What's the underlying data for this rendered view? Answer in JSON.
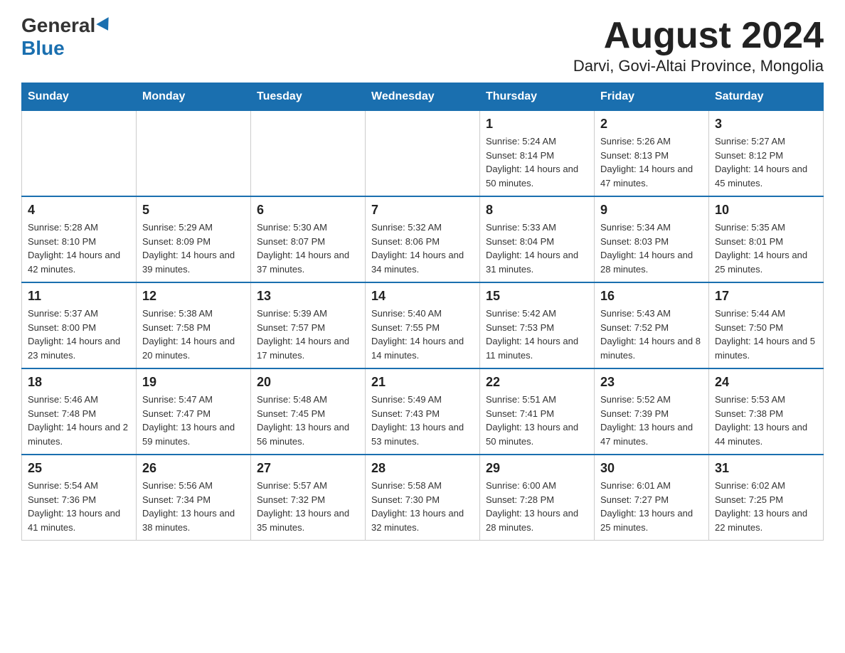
{
  "logo": {
    "general": "General",
    "blue": "Blue"
  },
  "title": "August 2024",
  "subtitle": "Darvi, Govi-Altai Province, Mongolia",
  "calendar": {
    "headers": [
      "Sunday",
      "Monday",
      "Tuesday",
      "Wednesday",
      "Thursday",
      "Friday",
      "Saturday"
    ],
    "weeks": [
      [
        {
          "day": "",
          "sunrise": "",
          "sunset": "",
          "daylight": ""
        },
        {
          "day": "",
          "sunrise": "",
          "sunset": "",
          "daylight": ""
        },
        {
          "day": "",
          "sunrise": "",
          "sunset": "",
          "daylight": ""
        },
        {
          "day": "",
          "sunrise": "",
          "sunset": "",
          "daylight": ""
        },
        {
          "day": "1",
          "sunrise": "Sunrise: 5:24 AM",
          "sunset": "Sunset: 8:14 PM",
          "daylight": "Daylight: 14 hours and 50 minutes."
        },
        {
          "day": "2",
          "sunrise": "Sunrise: 5:26 AM",
          "sunset": "Sunset: 8:13 PM",
          "daylight": "Daylight: 14 hours and 47 minutes."
        },
        {
          "day": "3",
          "sunrise": "Sunrise: 5:27 AM",
          "sunset": "Sunset: 8:12 PM",
          "daylight": "Daylight: 14 hours and 45 minutes."
        }
      ],
      [
        {
          "day": "4",
          "sunrise": "Sunrise: 5:28 AM",
          "sunset": "Sunset: 8:10 PM",
          "daylight": "Daylight: 14 hours and 42 minutes."
        },
        {
          "day": "5",
          "sunrise": "Sunrise: 5:29 AM",
          "sunset": "Sunset: 8:09 PM",
          "daylight": "Daylight: 14 hours and 39 minutes."
        },
        {
          "day": "6",
          "sunrise": "Sunrise: 5:30 AM",
          "sunset": "Sunset: 8:07 PM",
          "daylight": "Daylight: 14 hours and 37 minutes."
        },
        {
          "day": "7",
          "sunrise": "Sunrise: 5:32 AM",
          "sunset": "Sunset: 8:06 PM",
          "daylight": "Daylight: 14 hours and 34 minutes."
        },
        {
          "day": "8",
          "sunrise": "Sunrise: 5:33 AM",
          "sunset": "Sunset: 8:04 PM",
          "daylight": "Daylight: 14 hours and 31 minutes."
        },
        {
          "day": "9",
          "sunrise": "Sunrise: 5:34 AM",
          "sunset": "Sunset: 8:03 PM",
          "daylight": "Daylight: 14 hours and 28 minutes."
        },
        {
          "day": "10",
          "sunrise": "Sunrise: 5:35 AM",
          "sunset": "Sunset: 8:01 PM",
          "daylight": "Daylight: 14 hours and 25 minutes."
        }
      ],
      [
        {
          "day": "11",
          "sunrise": "Sunrise: 5:37 AM",
          "sunset": "Sunset: 8:00 PM",
          "daylight": "Daylight: 14 hours and 23 minutes."
        },
        {
          "day": "12",
          "sunrise": "Sunrise: 5:38 AM",
          "sunset": "Sunset: 7:58 PM",
          "daylight": "Daylight: 14 hours and 20 minutes."
        },
        {
          "day": "13",
          "sunrise": "Sunrise: 5:39 AM",
          "sunset": "Sunset: 7:57 PM",
          "daylight": "Daylight: 14 hours and 17 minutes."
        },
        {
          "day": "14",
          "sunrise": "Sunrise: 5:40 AM",
          "sunset": "Sunset: 7:55 PM",
          "daylight": "Daylight: 14 hours and 14 minutes."
        },
        {
          "day": "15",
          "sunrise": "Sunrise: 5:42 AM",
          "sunset": "Sunset: 7:53 PM",
          "daylight": "Daylight: 14 hours and 11 minutes."
        },
        {
          "day": "16",
          "sunrise": "Sunrise: 5:43 AM",
          "sunset": "Sunset: 7:52 PM",
          "daylight": "Daylight: 14 hours and 8 minutes."
        },
        {
          "day": "17",
          "sunrise": "Sunrise: 5:44 AM",
          "sunset": "Sunset: 7:50 PM",
          "daylight": "Daylight: 14 hours and 5 minutes."
        }
      ],
      [
        {
          "day": "18",
          "sunrise": "Sunrise: 5:46 AM",
          "sunset": "Sunset: 7:48 PM",
          "daylight": "Daylight: 14 hours and 2 minutes."
        },
        {
          "day": "19",
          "sunrise": "Sunrise: 5:47 AM",
          "sunset": "Sunset: 7:47 PM",
          "daylight": "Daylight: 13 hours and 59 minutes."
        },
        {
          "day": "20",
          "sunrise": "Sunrise: 5:48 AM",
          "sunset": "Sunset: 7:45 PM",
          "daylight": "Daylight: 13 hours and 56 minutes."
        },
        {
          "day": "21",
          "sunrise": "Sunrise: 5:49 AM",
          "sunset": "Sunset: 7:43 PM",
          "daylight": "Daylight: 13 hours and 53 minutes."
        },
        {
          "day": "22",
          "sunrise": "Sunrise: 5:51 AM",
          "sunset": "Sunset: 7:41 PM",
          "daylight": "Daylight: 13 hours and 50 minutes."
        },
        {
          "day": "23",
          "sunrise": "Sunrise: 5:52 AM",
          "sunset": "Sunset: 7:39 PM",
          "daylight": "Daylight: 13 hours and 47 minutes."
        },
        {
          "day": "24",
          "sunrise": "Sunrise: 5:53 AM",
          "sunset": "Sunset: 7:38 PM",
          "daylight": "Daylight: 13 hours and 44 minutes."
        }
      ],
      [
        {
          "day": "25",
          "sunrise": "Sunrise: 5:54 AM",
          "sunset": "Sunset: 7:36 PM",
          "daylight": "Daylight: 13 hours and 41 minutes."
        },
        {
          "day": "26",
          "sunrise": "Sunrise: 5:56 AM",
          "sunset": "Sunset: 7:34 PM",
          "daylight": "Daylight: 13 hours and 38 minutes."
        },
        {
          "day": "27",
          "sunrise": "Sunrise: 5:57 AM",
          "sunset": "Sunset: 7:32 PM",
          "daylight": "Daylight: 13 hours and 35 minutes."
        },
        {
          "day": "28",
          "sunrise": "Sunrise: 5:58 AM",
          "sunset": "Sunset: 7:30 PM",
          "daylight": "Daylight: 13 hours and 32 minutes."
        },
        {
          "day": "29",
          "sunrise": "Sunrise: 6:00 AM",
          "sunset": "Sunset: 7:28 PM",
          "daylight": "Daylight: 13 hours and 28 minutes."
        },
        {
          "day": "30",
          "sunrise": "Sunrise: 6:01 AM",
          "sunset": "Sunset: 7:27 PM",
          "daylight": "Daylight: 13 hours and 25 minutes."
        },
        {
          "day": "31",
          "sunrise": "Sunrise: 6:02 AM",
          "sunset": "Sunset: 7:25 PM",
          "daylight": "Daylight: 13 hours and 22 minutes."
        }
      ]
    ]
  }
}
